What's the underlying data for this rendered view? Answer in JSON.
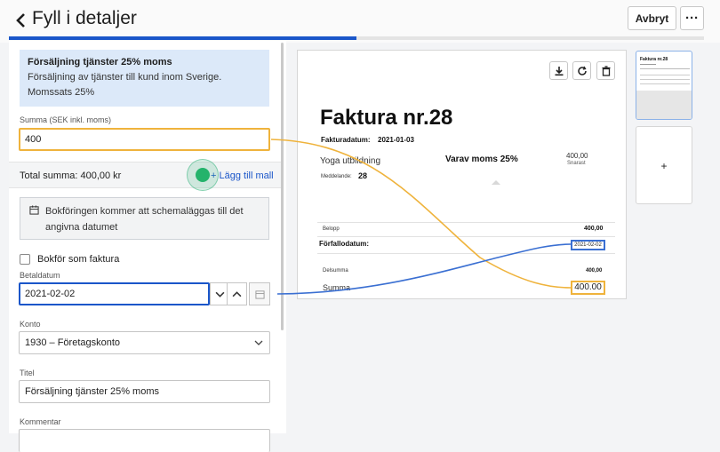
{
  "header": {
    "title": "Fyll i detaljer",
    "cancel_label": "Avbryt",
    "more_label": "···",
    "progress_fraction": 0.5
  },
  "template_info": {
    "title": "Försäljning tjänster 25% moms",
    "description": "Försäljning av tjänster till kund inom Sverige. Momssats 25%"
  },
  "sum_field": {
    "label": "Summa (SEK inkl. moms)",
    "value": "400"
  },
  "total": {
    "label": "Total summa: 400,00 kr",
    "add_template_label": "+ Lägg till mall"
  },
  "schedule_notice": {
    "text": "Bokföringen kommer att schemaläggas till det angivna datumet"
  },
  "invoice_checkbox": {
    "label": "Bokför som faktura",
    "checked": false
  },
  "due_date_field": {
    "label": "Betaldatum",
    "value": "2021-02-02"
  },
  "account_field": {
    "label": "Konto",
    "value": "1930 – Företagskonto"
  },
  "title_field": {
    "label": "Titel",
    "value": "Försäljning tjänster 25% moms"
  },
  "comment_field": {
    "label": "Kommentar"
  },
  "invoice_preview": {
    "title": "Faktura nr.28",
    "date_label": "Fakturadatum:",
    "date_value": "2021-01-03",
    "line_item": "Yoga utbildning",
    "vat_label": "Varav moms 25%",
    "amount_top": "400,00",
    "amount_top_sub": "Snarast",
    "message_label": "Meddelande:",
    "message_value": "28",
    "belopp_label": "Belopp",
    "belopp_value": "400,00",
    "due_label": "Förfallodatum:",
    "due_value": "2021-02-02",
    "subtotal_label": "Delsumma",
    "subtotal_value": "400,00",
    "total_label": "Summa",
    "total_value": "400.00"
  },
  "thumbnail": {
    "title": "Faktura nr.28"
  },
  "add_page_label": "+",
  "colors": {
    "accent_blue": "#1a56c9",
    "highlight_orange": "#efb33c",
    "link_blue": "#3a6fd2",
    "cursor_green": "#24b36b",
    "info_bg": "#dce9f9"
  },
  "icons": [
    "chevron-left-icon",
    "calendar-icon",
    "chevron-down-icon",
    "chevron-up-icon",
    "download-icon",
    "refresh-icon",
    "trash-icon"
  ]
}
